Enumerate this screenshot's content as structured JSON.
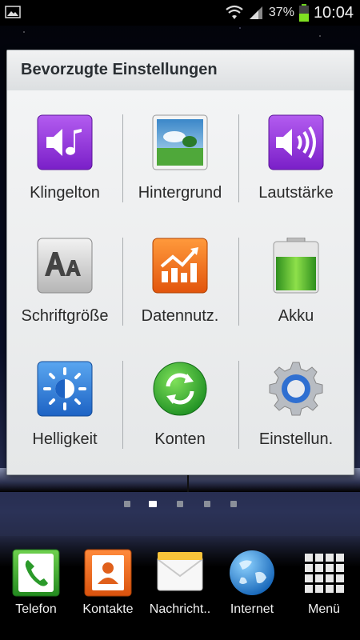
{
  "status_bar": {
    "battery_percent": "37%",
    "time": "10:04",
    "icons": [
      "picture-icon",
      "wifi-icon",
      "signal-icon",
      "battery-icon"
    ]
  },
  "panel": {
    "title": "Bevorzugte Einstellungen",
    "items": [
      {
        "label": "Klingelton",
        "icon": "ringtone-icon"
      },
      {
        "label": "Hintergrund",
        "icon": "wallpaper-icon"
      },
      {
        "label": "Lautstärke",
        "icon": "volume-icon"
      },
      {
        "label": "Schriftgröße",
        "icon": "font-size-icon"
      },
      {
        "label": "Datennutz.",
        "icon": "data-usage-icon"
      },
      {
        "label": "Akku",
        "icon": "battery-icon"
      },
      {
        "label": "Helligkeit",
        "icon": "brightness-icon"
      },
      {
        "label": "Konten",
        "icon": "sync-accounts-icon"
      },
      {
        "label": "Einstellun.",
        "icon": "settings-gear-icon"
      }
    ]
  },
  "pager": {
    "pages": 5,
    "active": 2
  },
  "dock": {
    "items": [
      {
        "label": "Telefon",
        "icon": "phone-icon"
      },
      {
        "label": "Kontakte",
        "icon": "contacts-icon"
      },
      {
        "label": "Nachricht..",
        "icon": "messages-icon"
      },
      {
        "label": "Internet",
        "icon": "globe-icon"
      },
      {
        "label": "Menü",
        "icon": "apps-grid-icon"
      }
    ]
  },
  "colors": {
    "panel_bg": "#e9ebec",
    "purple": "#8a2be2",
    "orange": "#f36b1c",
    "green": "#3cae3c",
    "blue": "#2f7fd6"
  }
}
